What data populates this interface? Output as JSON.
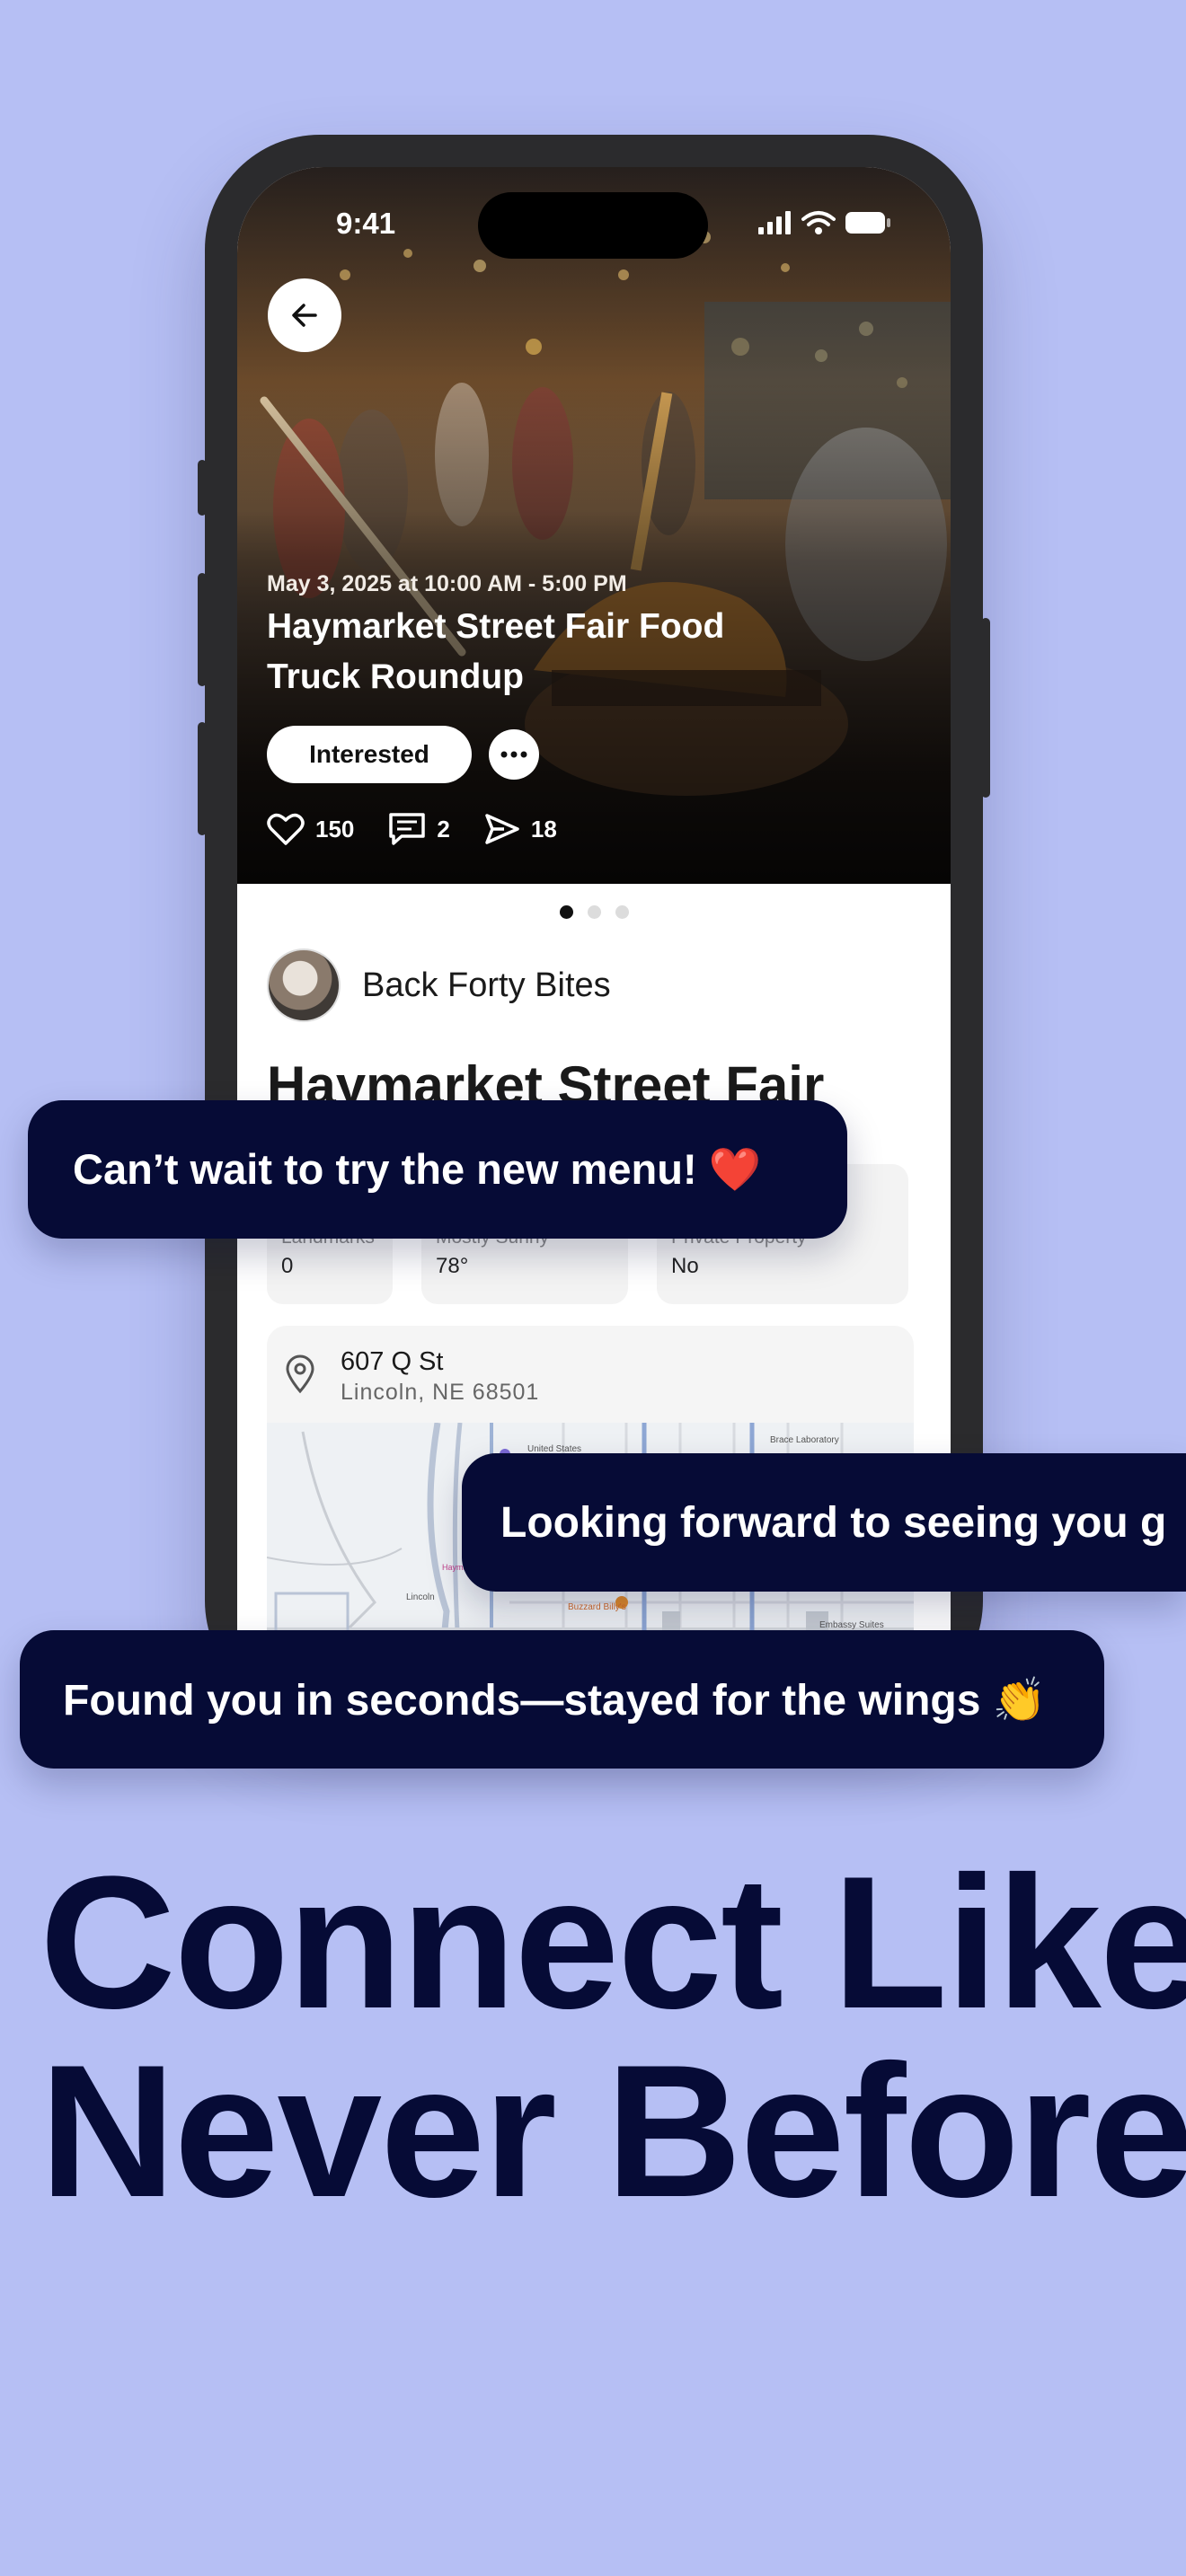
{
  "status_bar": {
    "time": "9:41"
  },
  "event": {
    "date": "May 3, 2025 at 10:00 AM - 5:00 PM",
    "title_line1": "Haymarket Street Fair Food",
    "title_line2": "Truck Roundup",
    "interested_label": "Interested",
    "likes": "150",
    "comments": "2",
    "shares": "18",
    "carousel_pages": 3,
    "carousel_active_index": 0
  },
  "author": {
    "name": "Back Forty Bites"
  },
  "body_title": "Haymarket Street Fair",
  "info": [
    {
      "label": "Landmarks",
      "value": "0"
    },
    {
      "label": "Mostly Sunny",
      "value": "78°"
    },
    {
      "label": "Private Property",
      "value": "No"
    }
  ],
  "address": {
    "street": "607 Q St",
    "city": "Lincoln, NE 68501"
  },
  "map_labels": [
    "United States",
    "Brace Laboratory",
    "Lincoln",
    "Haymarket Discovery",
    "Buzzard Billy's",
    "Embassy Suites"
  ],
  "bubbles": {
    "b1": "Can’t wait to try the new menu!  ❤️",
    "b2": "Looking forward to seeing you g",
    "b3": "Found you in seconds—stayed for the wings 👏"
  },
  "headline": {
    "line1": "Connect Like",
    "line2": "Never Before"
  },
  "colors": {
    "background": "#b6bff4",
    "navy": "#060b36",
    "phone_frame": "#2b2b2d",
    "heart": "#e0202a"
  }
}
